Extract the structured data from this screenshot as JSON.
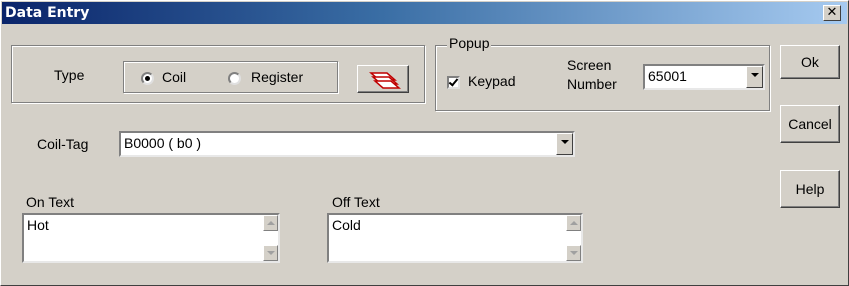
{
  "window": {
    "title": "Data Entry",
    "close_glyph": "✕"
  },
  "type_group": {
    "label": "Type",
    "options": [
      {
        "label": "Coil",
        "checked": true
      },
      {
        "label": "Register",
        "checked": false
      }
    ],
    "copy_icon": "copy-pages-icon"
  },
  "popup_group": {
    "legend": "Popup",
    "keypad_label": "Keypad",
    "keypad_checked": true,
    "screen_label_line1": "Screen",
    "screen_label_line2": "Number",
    "screen_number": "65001"
  },
  "coil_tag": {
    "label": "Coil-Tag",
    "value": "B0000 ( b0 )"
  },
  "on_text": {
    "label": "On Text",
    "value": "Hot"
  },
  "off_text": {
    "label": "Off Text",
    "value": "Cold"
  },
  "buttons": {
    "ok": "Ok",
    "cancel": "Cancel",
    "help": "Help"
  },
  "colors": {
    "face": "#d4d0c8",
    "titlebar_start": "#0a246a",
    "titlebar_end": "#a6caf0",
    "icon_red": "#c00000"
  }
}
